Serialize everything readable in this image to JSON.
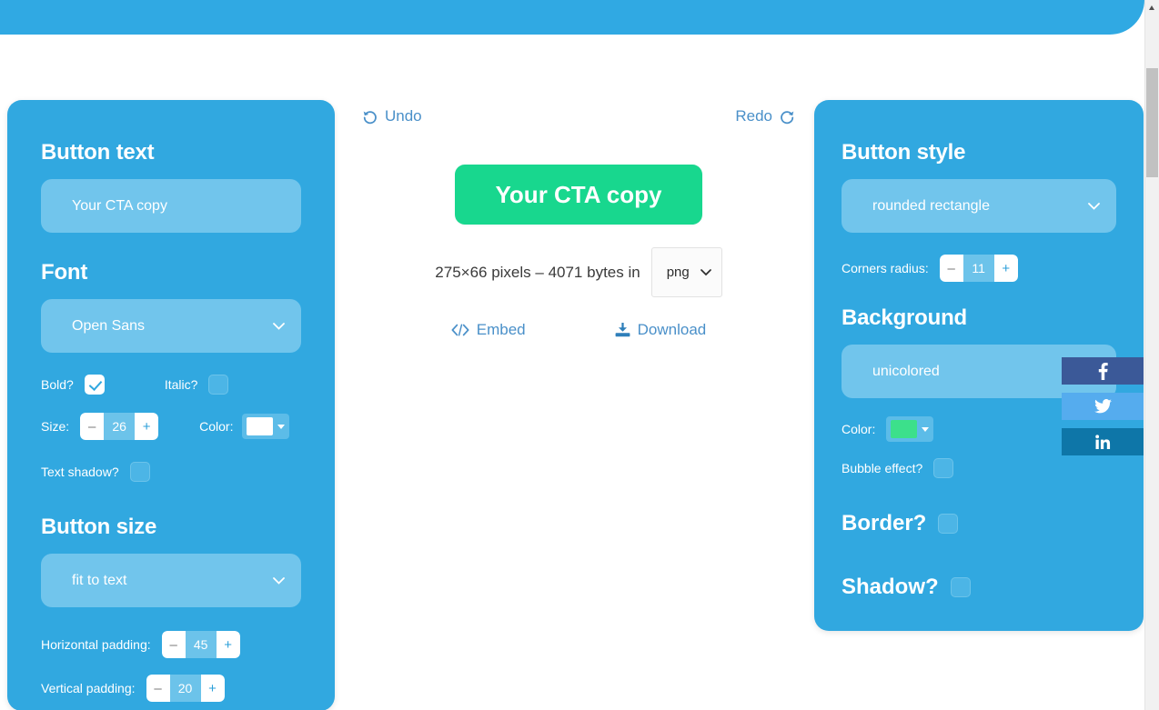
{
  "left_panel": {
    "button_text": {
      "title": "Button text",
      "value": "Your CTA copy",
      "placeholder": "Your CTA copy"
    },
    "font": {
      "title": "Font",
      "selected": "Open Sans",
      "bold_label": "Bold?",
      "bold_checked": true,
      "italic_label": "Italic?",
      "italic_checked": false,
      "size_label": "Size:",
      "size_value": "26",
      "color_label": "Color:",
      "color_value": "#ffffff",
      "text_shadow_label": "Text shadow?",
      "text_shadow_checked": false,
      "minus": "–",
      "plus": "+"
    },
    "button_size": {
      "title": "Button size",
      "selected": "fit to text",
      "horizontal_label": "Horizontal padding:",
      "horizontal_value": "45",
      "vertical_label": "Vertical padding:",
      "vertical_value": "20",
      "minus": "–",
      "plus": "+"
    }
  },
  "center": {
    "undo_label": "Undo",
    "redo_label": "Redo",
    "cta_text": "Your CTA copy",
    "cta_color": "#18d78e",
    "meta_text": "275×66 pixels – 4071 bytes in",
    "format_selected": "png",
    "embed_label": "Embed",
    "download_label": "Download"
  },
  "right_panel": {
    "button_style": {
      "title": "Button style",
      "selected": "rounded rectangle",
      "corners_label": "Corners radius:",
      "corners_value": "11",
      "minus": "–",
      "plus": "+"
    },
    "background": {
      "title": "Background",
      "selected": "unicolored",
      "color_label": "Color:",
      "color_value": "#3ce08b",
      "bubble_label": "Bubble effect?",
      "bubble_checked": false
    },
    "border": {
      "label": "Border?",
      "checked": false
    },
    "shadow": {
      "label": "Shadow?",
      "checked": false
    }
  },
  "social": {
    "facebook": "facebook-share",
    "twitter": "twitter-share",
    "linkedin": "linkedin-share"
  },
  "theme": {
    "banner_color": "#30a9e3",
    "panel_color": "#31a8e0",
    "field_color": "#71c5ec",
    "link_color": "#4a90c9"
  }
}
